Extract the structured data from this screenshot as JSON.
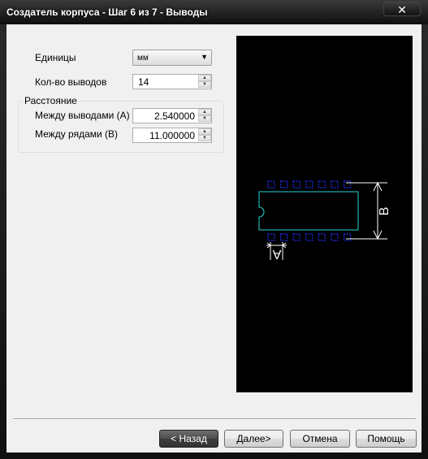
{
  "window": {
    "title": "Создатель корпуса - Шаг 6 из 7 - Выводы",
    "close_glyph": "✕"
  },
  "form": {
    "units_label": "Единицы",
    "units_value": "мм",
    "pin_count_label": "Кол-во выводов",
    "pin_count_value": "14",
    "spacing_group_label": "Расстояние",
    "pin_pitch_label": "Между выводами (A)",
    "pin_pitch_value": "2.540000",
    "row_spacing_label": "Между рядами (B)",
    "row_spacing_value": "11.000000"
  },
  "preview": {
    "dim_a_label": "A",
    "dim_b_label": "B",
    "pins_per_row": 7,
    "pad_color": "#1d2bd8",
    "body_color": "#29d5d5",
    "dim_color": "#ffffff"
  },
  "buttons": {
    "back": "< Назад",
    "next": "Далее>",
    "cancel": "Отмена",
    "help": "Помощь"
  }
}
